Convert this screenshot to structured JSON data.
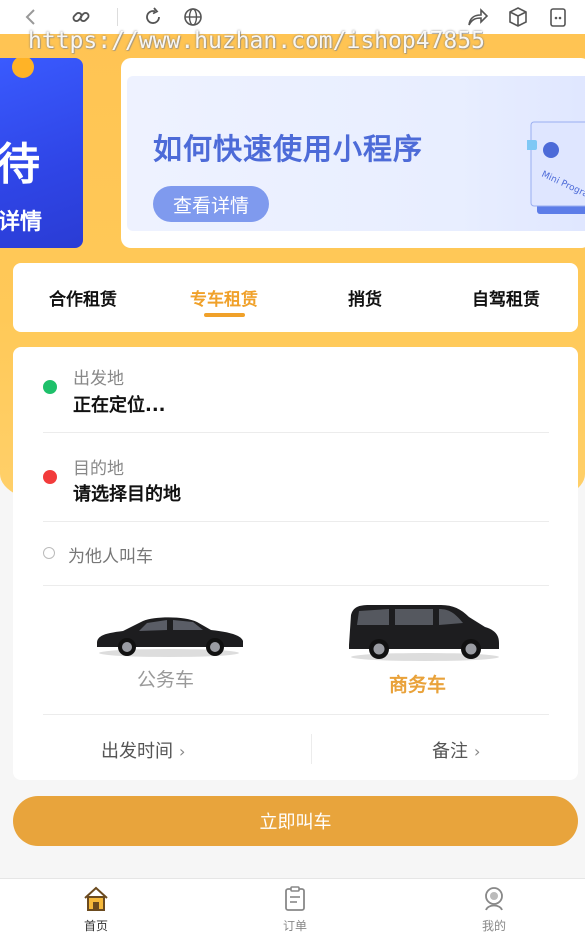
{
  "watermark": "https://www.huzhan.com/ishop47855",
  "banner_left": {
    "big_text": "待",
    "detail_text": "详情"
  },
  "banner": {
    "title": "如何快速使用小程序",
    "button_label": "查看详情",
    "book_text": "Mini Program"
  },
  "tabs": [
    {
      "label": "合作租赁"
    },
    {
      "label": "专车租赁",
      "active": true
    },
    {
      "label": "捎货"
    },
    {
      "label": "自驾租赁"
    }
  ],
  "booking": {
    "departure_label": "出发地",
    "departure_value": "正在定位...",
    "destination_label": "目的地",
    "destination_value": "请选择目的地",
    "other_label": "为他人叫车",
    "cars": [
      {
        "label": "公务车",
        "selected": false
      },
      {
        "label": "商务车",
        "selected": true
      }
    ],
    "time_label": "出发时间",
    "remark_label": "备注",
    "chevron": "›"
  },
  "call_button_label": "立即叫车",
  "nav": [
    {
      "label": "首页",
      "icon": "home-icon",
      "active": true
    },
    {
      "label": "订单",
      "icon": "order-icon",
      "active": false
    },
    {
      "label": "我的",
      "icon": "profile-icon",
      "active": false
    }
  ],
  "colors": {
    "accent": "#f0a12a",
    "button": "#e8a43c",
    "hero": "#ffc453",
    "green_dot": "#1ec06a",
    "red_dot": "#f23b3b",
    "banner_blue": "#4d6bd8"
  }
}
